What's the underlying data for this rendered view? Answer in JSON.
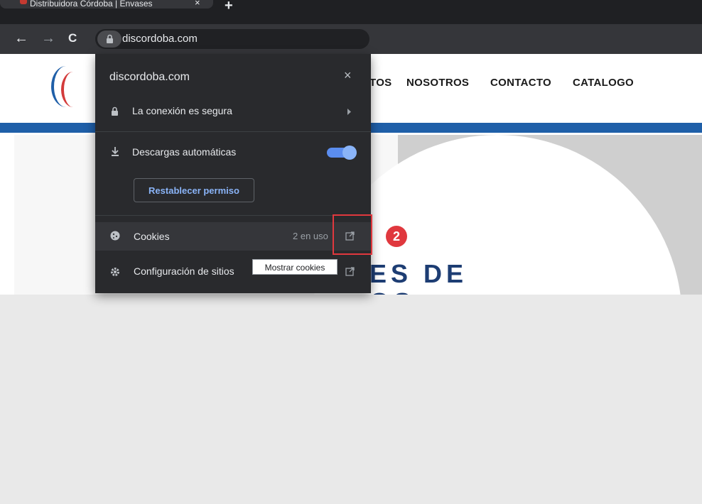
{
  "tab": {
    "title": "Distribuidora Córdoba | Envases",
    "close": "×",
    "new_tab": "+"
  },
  "toolbar": {
    "back": "←",
    "forward": "→",
    "reload": "C",
    "url": "discordoba.com"
  },
  "site_nav": {
    "items": [
      "TOS",
      "NOSOTROS",
      "CONTACTO",
      "CATALOGO"
    ]
  },
  "hero": {
    "line1": "ES DE",
    "line2": "OS"
  },
  "popup": {
    "title": "discordoba.com",
    "close": "×",
    "connection": "La conexión es segura",
    "downloads": "Descargas automáticas",
    "toggle_on": true,
    "reset_button": "Restablecer permiso",
    "cookies": "Cookies",
    "cookies_count": "2 en uso",
    "site_settings": "Configuración de sitios",
    "tooltip": "Mostrar cookies"
  },
  "annotation": {
    "badge": "2",
    "color": "#e0383e"
  }
}
